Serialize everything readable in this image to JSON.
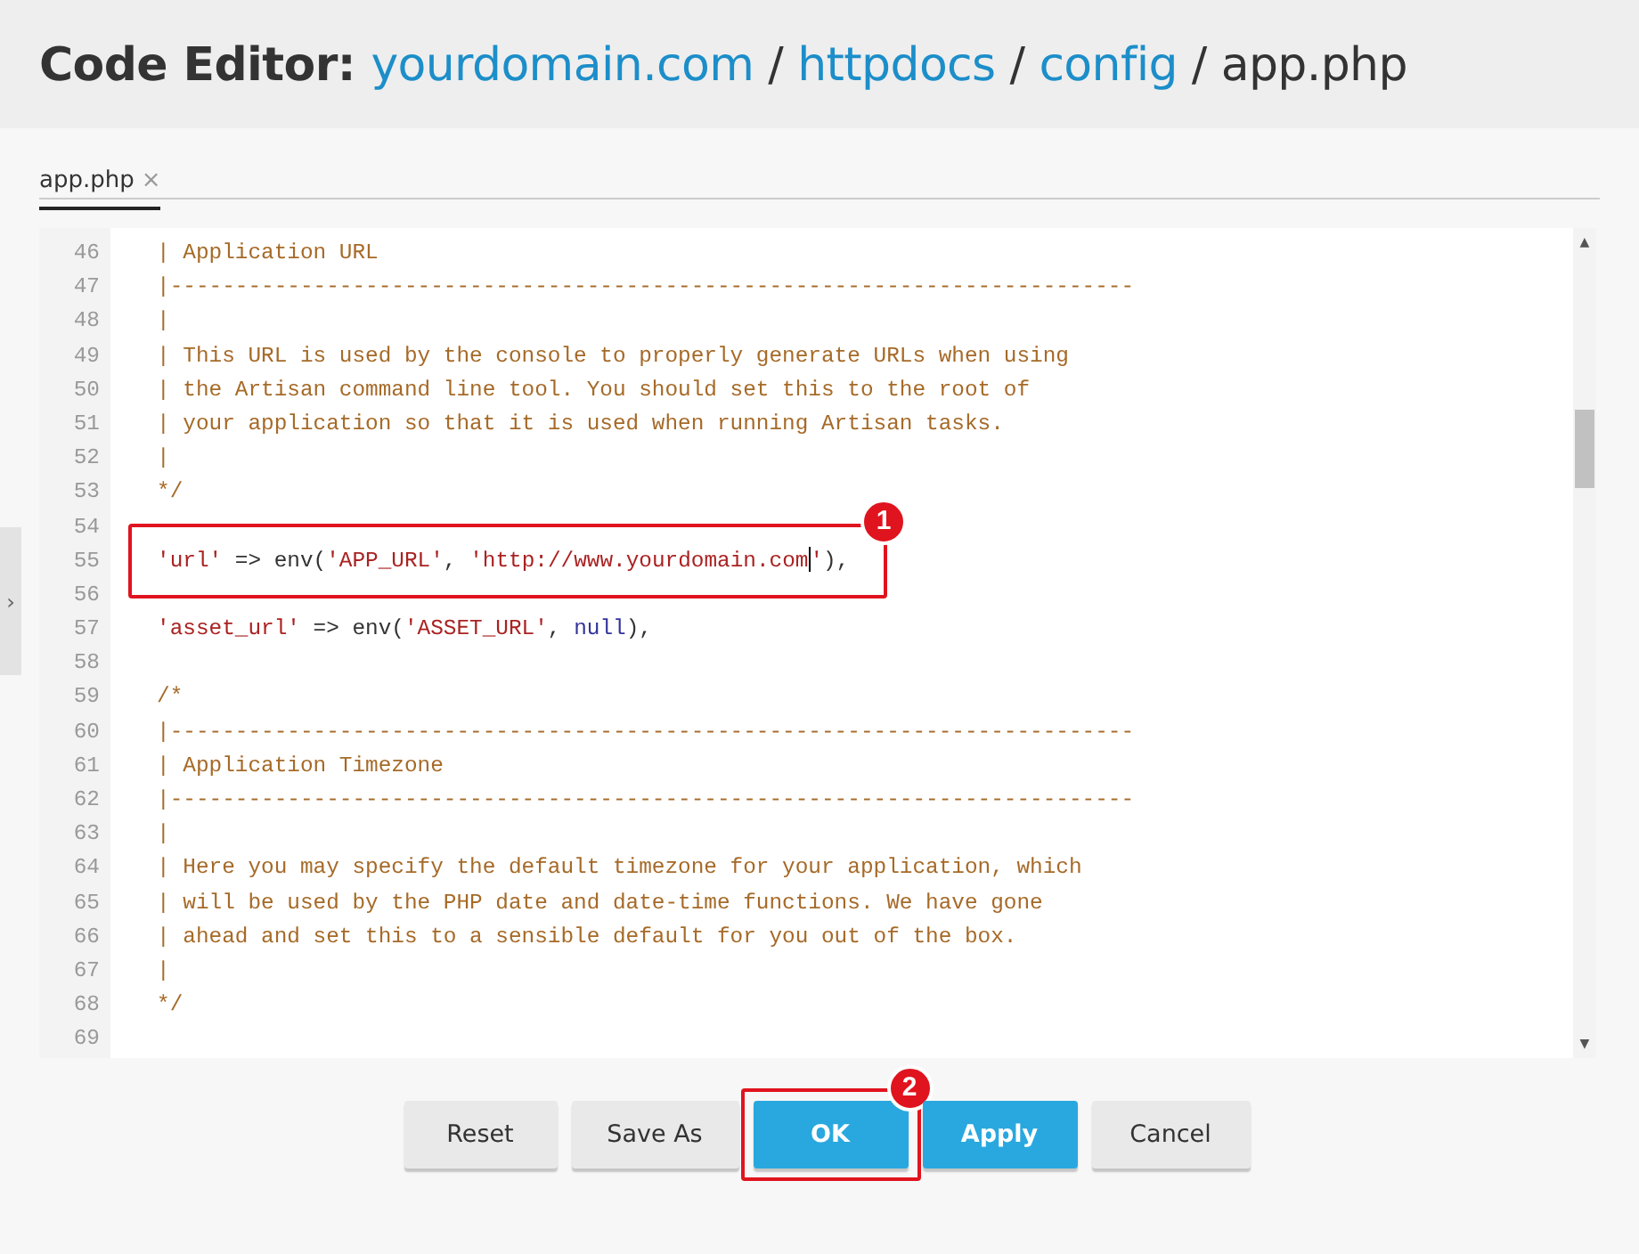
{
  "title": {
    "label": "Code Editor:",
    "crumbs": [
      {
        "text": "yourdomain.com",
        "kind": "link"
      },
      {
        "text": "httpdocs",
        "kind": "link",
        "separator": "/"
      },
      {
        "text": "config",
        "kind": "link",
        "separator": "/"
      },
      {
        "text": "app.php",
        "kind": "current",
        "separator": "/"
      }
    ]
  },
  "side_handle": {
    "icon": "›"
  },
  "scrollbar": {
    "up": "▲",
    "down": "▼"
  },
  "tabs": [
    {
      "label": "app.php",
      "close": "×",
      "selected": true
    }
  ],
  "editor": {
    "lines": [
      {
        "number": "46",
        "segments": [
          {
            "kind": "comment",
            "text": "| Application URL"
          }
        ]
      },
      {
        "number": "47",
        "segments": [
          {
            "kind": "comment",
            "text": "|--------------------------------------------------------------------------"
          }
        ]
      },
      {
        "number": "48",
        "segments": [
          {
            "kind": "comment",
            "text": "|"
          }
        ]
      },
      {
        "number": "49",
        "segments": [
          {
            "kind": "comment",
            "text": "| This URL is used by the console to properly generate URLs when using"
          }
        ]
      },
      {
        "number": "50",
        "segments": [
          {
            "kind": "comment",
            "text": "| the Artisan command line tool. You should set this to the root of"
          }
        ]
      },
      {
        "number": "51",
        "segments": [
          {
            "kind": "comment",
            "text": "| your application so that it is used when running Artisan tasks."
          }
        ]
      },
      {
        "number": "52",
        "segments": [
          {
            "kind": "comment",
            "text": "|"
          }
        ]
      },
      {
        "number": "53",
        "segments": [
          {
            "kind": "comment",
            "text": "*/"
          }
        ]
      },
      {
        "number": "54"
      },
      {
        "number": "55",
        "callout": "1",
        "segments": [
          {
            "kind": "string",
            "text": "'url'"
          },
          {
            "kind": "plain",
            "text": " => env("
          },
          {
            "kind": "string",
            "text": "'APP_URL'"
          },
          {
            "kind": "plain",
            "text": ", "
          },
          {
            "kind": "string",
            "text": "'http://www.yourdomain.com"
          },
          {
            "kind": "caret"
          },
          {
            "kind": "string",
            "text": "'"
          },
          {
            "kind": "plain",
            "text": "),"
          }
        ]
      },
      {
        "number": "56"
      },
      {
        "number": "57",
        "segments": [
          {
            "kind": "string",
            "text": "'asset_url'"
          },
          {
            "kind": "plain",
            "text": " => env("
          },
          {
            "kind": "string",
            "text": "'ASSET_URL'"
          },
          {
            "kind": "plain",
            "text": ", "
          },
          {
            "kind": "keyword",
            "text": "null"
          },
          {
            "kind": "plain",
            "text": "),"
          }
        ]
      },
      {
        "number": "58"
      },
      {
        "number": "59",
        "segments": [
          {
            "kind": "comment",
            "text": "/*"
          }
        ]
      },
      {
        "number": "60",
        "segments": [
          {
            "kind": "comment",
            "text": "|--------------------------------------------------------------------------"
          }
        ]
      },
      {
        "number": "61",
        "segments": [
          {
            "kind": "comment",
            "text": "| Application Timezone"
          }
        ]
      },
      {
        "number": "62",
        "segments": [
          {
            "kind": "comment",
            "text": "|--------------------------------------------------------------------------"
          }
        ]
      },
      {
        "number": "63",
        "segments": [
          {
            "kind": "comment",
            "text": "|"
          }
        ]
      },
      {
        "number": "64",
        "segments": [
          {
            "kind": "comment",
            "text": "| Here you may specify the default timezone for your application, which"
          }
        ]
      },
      {
        "number": "65",
        "segments": [
          {
            "kind": "comment",
            "text": "| will be used by the PHP date and date-time functions. We have gone"
          }
        ]
      },
      {
        "number": "66",
        "segments": [
          {
            "kind": "comment",
            "text": "| ahead and set this to a sensible default for you out of the box."
          }
        ]
      },
      {
        "number": "67",
        "segments": [
          {
            "kind": "comment",
            "text": "|"
          }
        ]
      },
      {
        "number": "68",
        "segments": [
          {
            "kind": "comment",
            "text": "*/"
          }
        ]
      },
      {
        "number": "69"
      }
    ]
  },
  "buttons": [
    {
      "label": "Reset",
      "kind": "default"
    },
    {
      "label": "Save As",
      "kind": "default"
    },
    {
      "label": "OK",
      "kind": "primary",
      "callout": "2"
    },
    {
      "label": "Apply",
      "kind": "primary"
    },
    {
      "label": "Cancel",
      "kind": "default"
    }
  ]
}
